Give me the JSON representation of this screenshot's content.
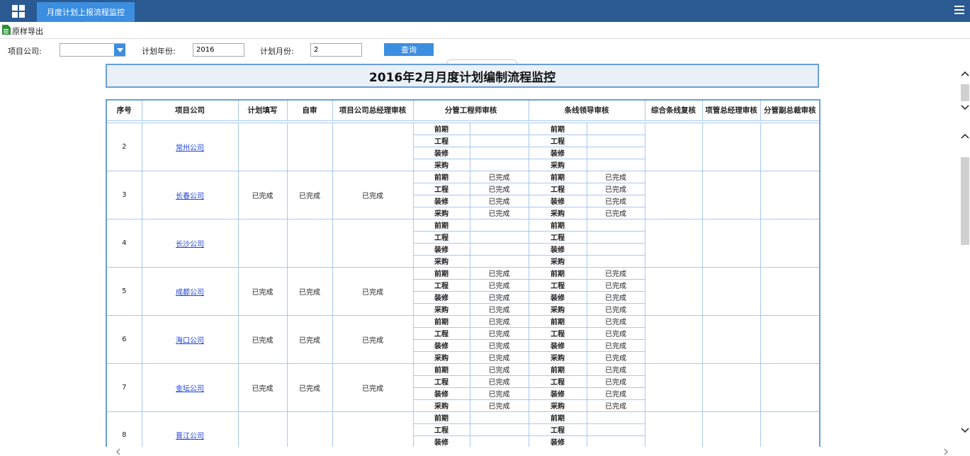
{
  "header": {
    "tab_title": "月度计划上报流程监控"
  },
  "toolbar": {
    "export_label": "原样导出"
  },
  "filters": {
    "company_label": "项目公司:",
    "company_value": "",
    "year_label": "计划年份:",
    "year_value": "2016",
    "month_label": "计划月份:",
    "month_value": "2",
    "search_label": "查询"
  },
  "report": {
    "title": "2016年2月月度计划编制流程监控",
    "columns": {
      "seq": "序号",
      "company": "项目公司",
      "plan_fill": "计划填写",
      "self_review": "自审",
      "gm_review": "项目公司总经理审核",
      "engineer_review": "分管工程师审核",
      "leader_review": "条线领导审核",
      "combined_review": "综合条线复核",
      "pm_gm_review": "项管总经理审核",
      "vp_review": "分管副总裁审核"
    },
    "stages": [
      "前期",
      "工程",
      "装修",
      "采购"
    ],
    "rows": [
      {
        "seq": "2",
        "company": "常州公司",
        "plan_fill": "",
        "self_review": "",
        "gm_review": "",
        "engineer": [
          "",
          "",
          "",
          ""
        ],
        "leader": [
          "",
          "",
          "",
          ""
        ]
      },
      {
        "seq": "3",
        "company": "长春公司",
        "plan_fill": "已完成",
        "self_review": "已完成",
        "gm_review": "已完成",
        "engineer": [
          "已完成",
          "已完成",
          "已完成",
          "已完成"
        ],
        "leader": [
          "已完成",
          "已完成",
          "已完成",
          "已完成"
        ]
      },
      {
        "seq": "4",
        "company": "长沙公司",
        "plan_fill": "",
        "self_review": "",
        "gm_review": "",
        "engineer": [
          "",
          "",
          "",
          ""
        ],
        "leader": [
          "",
          "",
          "",
          ""
        ]
      },
      {
        "seq": "5",
        "company": "成都公司",
        "plan_fill": "已完成",
        "self_review": "已完成",
        "gm_review": "已完成",
        "engineer": [
          "已完成",
          "已完成",
          "已完成",
          "已完成"
        ],
        "leader": [
          "已完成",
          "已完成",
          "已完成",
          "已完成"
        ]
      },
      {
        "seq": "6",
        "company": "海口公司",
        "plan_fill": "已完成",
        "self_review": "已完成",
        "gm_review": "已完成",
        "engineer": [
          "已完成",
          "已完成",
          "已完成",
          "已完成"
        ],
        "leader": [
          "已完成",
          "已完成",
          "已完成",
          "已完成"
        ]
      },
      {
        "seq": "7",
        "company": "金坛公司",
        "plan_fill": "已完成",
        "self_review": "已完成",
        "gm_review": "已完成",
        "engineer": [
          "已完成",
          "已完成",
          "已完成",
          "已完成"
        ],
        "leader": [
          "已完成",
          "已完成",
          "已完成",
          "已完成"
        ]
      },
      {
        "seq": "8",
        "company": "晋江公司",
        "plan_fill": "",
        "self_review": "",
        "gm_review": "",
        "engineer": [
          "",
          "",
          "",
          ""
        ],
        "leader": [
          "",
          "",
          "",
          ""
        ]
      }
    ]
  },
  "colors": {
    "topbar": "#2b5a93",
    "accent": "#3c8ee0",
    "grid_border": "#6a9fd8",
    "link": "#1a3fd6"
  }
}
